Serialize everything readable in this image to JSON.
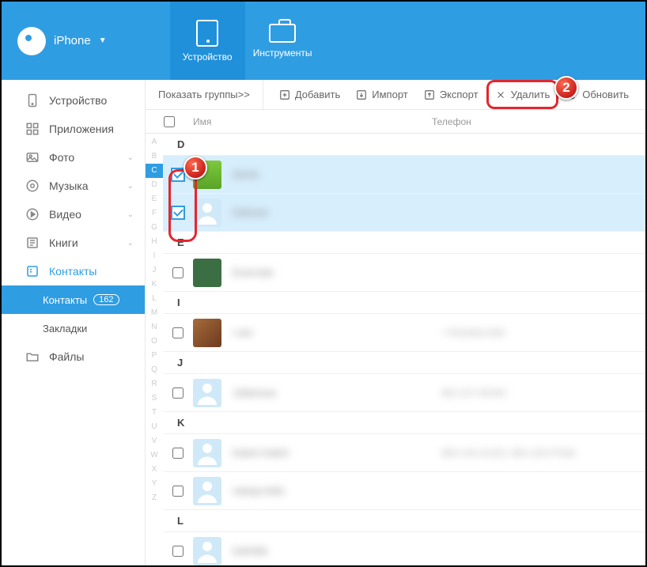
{
  "header": {
    "device_label": "iPhone",
    "tabs": {
      "device": "Устройство",
      "tools": "Инструменты"
    }
  },
  "sidebar": {
    "device": "Устройство",
    "apps": "Приложения",
    "photo": "Фото",
    "music": "Музыка",
    "video": "Видео",
    "books": "Книги",
    "contacts": "Контакты",
    "contacts_sub": "Контакты",
    "contacts_count": "162",
    "bookmarks": "Закладки",
    "files": "Файлы"
  },
  "toolbar": {
    "groups": "Показать группы>>",
    "add": "Добавить",
    "import": "Импорт",
    "export": "Экспорт",
    "delete": "Удалить",
    "refresh": "Обновить"
  },
  "columns": {
    "name": "Имя",
    "phone": "Телефон"
  },
  "az": [
    "A",
    "B",
    "C",
    "D",
    "E",
    "F",
    "G",
    "H",
    "I",
    "J",
    "K",
    "L",
    "M",
    "N",
    "O",
    "P",
    "Q",
    "R",
    "S",
    "T",
    "U",
    "V",
    "W",
    "X",
    "Y",
    "Z"
  ],
  "az_current": "C",
  "sections": [
    {
      "letter": "D",
      "rows": [
        {
          "selected": true,
          "avatar": "green",
          "name": "Denis",
          "phone": ""
        },
        {
          "selected": true,
          "avatar": "default",
          "name": "Defuser",
          "phone": ""
        }
      ]
    },
    {
      "letter": "E",
      "rows": [
        {
          "selected": false,
          "avatar": "dark",
          "name": "Evernote",
          "phone": ""
        }
      ]
    },
    {
      "letter": "I",
      "rows": [
        {
          "selected": false,
          "avatar": "photo",
          "name": "I am",
          "phone": "+79150621465"
        }
      ]
    },
    {
      "letter": "J",
      "rows": [
        {
          "selected": false,
          "avatar": "default",
          "name": "Julianova",
          "phone": "891-227-00344"
        }
      ]
    },
    {
      "letter": "K",
      "rows": [
        {
          "selected": false,
          "avatar": "default",
          "name": "Katrin Katrin",
          "phone": "993-143-21423, 993-135-07505"
        },
        {
          "selected": false,
          "avatar": "default",
          "name": "nastya kido",
          "phone": ""
        }
      ]
    },
    {
      "letter": "L",
      "rows": [
        {
          "selected": false,
          "avatar": "default",
          "name": "ludmilla",
          "phone": ""
        }
      ]
    }
  ],
  "callouts": {
    "one": "1",
    "two": "2"
  }
}
